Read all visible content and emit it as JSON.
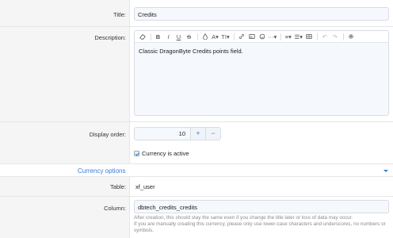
{
  "title_row": {
    "label": "Title:",
    "value": "Credits"
  },
  "description_row": {
    "label": "Description:",
    "content": "Classic DragonByte Credits points field."
  },
  "toolbar": {
    "icons": [
      "eraser-icon",
      "bold-icon",
      "italic-icon",
      "underline-icon",
      "strikethrough-icon",
      "color-icon",
      "font-size-icon",
      "text-size-icon",
      "link-icon",
      "image-icon",
      "smilie-icon",
      "more-icon",
      "align-icon",
      "list-icon",
      "table-icon",
      "undo-icon",
      "redo-icon",
      "settings-icon"
    ],
    "glyphs": {
      "bold": "B",
      "italic": "I",
      "underline": "U",
      "strike": "S",
      "font_color": "A",
      "text_size": "TI",
      "more": "···",
      "align": "≡",
      "list": "☰",
      "undo": "↶",
      "redo": "↷"
    }
  },
  "display_order_row": {
    "label": "Display order:",
    "value": "10",
    "plus": "+",
    "minus": "−"
  },
  "active_checkbox": {
    "label": "Currency is active",
    "checked": true
  },
  "section": {
    "title": "Currency options"
  },
  "table_row": {
    "label": "Table:",
    "value": "xf_user"
  },
  "column_row": {
    "label": "Column:",
    "value": "dbtech_credits_credits",
    "explain": [
      "After creation, this should stay the same even if you change the title later or loss of data may occur.",
      "If you are manually creating this currency, please only use lower-case characters and underscores, no numbers or",
      "symbols."
    ]
  },
  "colors": {
    "accent": "#3a7bd5",
    "label_bg": "#f5f5f5",
    "field_bg": "#f5f8fc"
  }
}
